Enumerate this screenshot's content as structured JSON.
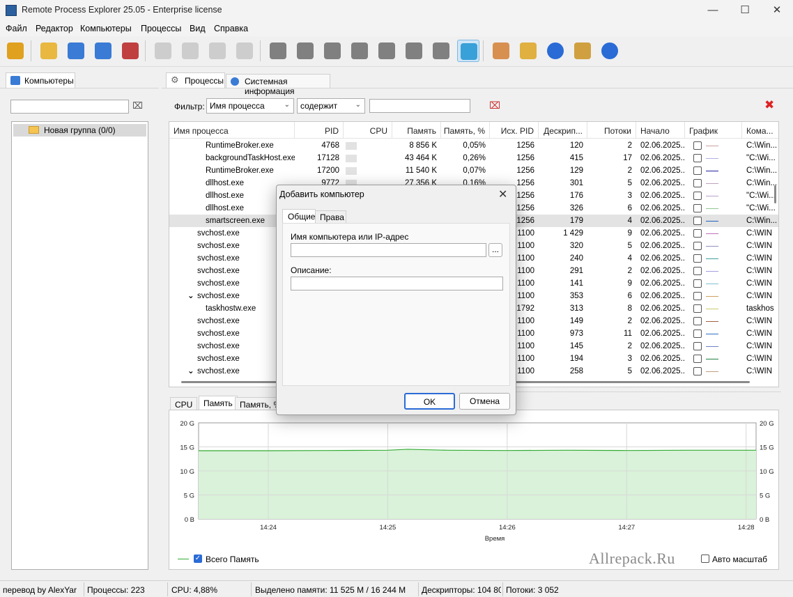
{
  "window": {
    "title": "Remote Process Explorer 25.05 - Enterprise license",
    "min_glyph": "—",
    "max_glyph": "☐",
    "close_glyph": "✕"
  },
  "menu": [
    "Файл",
    "Редактор",
    "Компьютеры",
    "Процессы",
    "Вид",
    "Справка"
  ],
  "toolbar_icons": [
    "wizard-icon",
    "add-folder-icon",
    "add-computer-icon",
    "edit-computer-icon",
    "remove-computer-icon",
    "run-process-icon",
    "run-as-icon",
    "kill-process-icon",
    "kill-tree-icon",
    "service-settings-icon",
    "add-service-icon",
    "remove-service-icon",
    "service-priority-icon",
    "find-service-icon",
    "network-service-icon",
    "service-properties-icon",
    "filter-icon",
    "user-key-icon",
    "tools-icon",
    "help-icon",
    "home-icon",
    "info-icon"
  ],
  "left": {
    "tab": "Компьютеры",
    "filter_value": "",
    "tree_item": "Новая группа (0/0)"
  },
  "tabs": {
    "processes": "Процессы",
    "sysinfo": "Системная информация"
  },
  "filter": {
    "label": "Фильтр:",
    "field": "Имя процесса",
    "op": "содержит",
    "value": ""
  },
  "columns": [
    "Имя процесса",
    "PID",
    "CPU",
    "Память",
    "Память, %",
    "Исх. PID",
    "Дескрип...",
    "Потоки",
    "Начало",
    "График",
    "Кома..."
  ],
  "rows": [
    {
      "name": "RuntimeBroker.exe",
      "indent": 2,
      "pid": "4768",
      "mem": "8 856 K",
      "memp": "0,05%",
      "ppid": "1256",
      "handles": "120",
      "threads": "2",
      "start": "02.06.2025...",
      "color": "#c9a0a0",
      "cmd": "C:\\Win..."
    },
    {
      "name": "backgroundTaskHost.exe",
      "indent": 2,
      "pid": "17128",
      "mem": "43 464 K",
      "memp": "0,26%",
      "ppid": "1256",
      "handles": "415",
      "threads": "17",
      "start": "02.06.2025...",
      "color": "#b0b0e0",
      "cmd": "\"C:\\Wi..."
    },
    {
      "name": "RuntimeBroker.exe",
      "indent": 2,
      "pid": "17200",
      "mem": "11 540 K",
      "memp": "0,07%",
      "ppid": "1256",
      "handles": "129",
      "threads": "2",
      "start": "02.06.2025...",
      "color": "#2020a0",
      "cmd": "C:\\Win..."
    },
    {
      "name": "dllhost.exe",
      "indent": 2,
      "pid": "9772",
      "mem": "27 356 K",
      "memp": "0,16%",
      "ppid": "1256",
      "handles": "301",
      "threads": "5",
      "start": "02.06.2025...",
      "color": "#c0a0c0",
      "cmd": "C:\\Win..."
    },
    {
      "name": "dllhost.exe",
      "indent": 2,
      "pid": "",
      "mem": "",
      "memp": "",
      "ppid": "1256",
      "handles": "176",
      "threads": "3",
      "start": "02.06.2025...",
      "color": "#b8a0c8",
      "cmd": "\"C:\\Wi..."
    },
    {
      "name": "dllhost.exe",
      "indent": 2,
      "pid": "",
      "mem": "",
      "memp": "",
      "ppid": "1256",
      "handles": "326",
      "threads": "6",
      "start": "02.06.2025...",
      "color": "#90c890",
      "cmd": "\"C:\\Wi..."
    },
    {
      "name": "smartscreen.exe",
      "indent": 2,
      "pid": "",
      "mem": "",
      "memp": "",
      "ppid": "1256",
      "handles": "179",
      "threads": "4",
      "start": "02.06.2025...",
      "color": "#2060c0",
      "cmd": "C:\\Win...",
      "selected": true
    },
    {
      "name": "svchost.exe",
      "indent": 1,
      "pid": "",
      "mem": "",
      "memp": "",
      "ppid": "1100",
      "handles": "1 429",
      "threads": "9",
      "start": "02.06.2025...",
      "color": "#c070c0",
      "cmd": "C:\\WIN"
    },
    {
      "name": "svchost.exe",
      "indent": 1,
      "pid": "",
      "mem": "",
      "memp": "",
      "ppid": "1100",
      "handles": "320",
      "threads": "5",
      "start": "02.06.2025...",
      "color": "#9090c0",
      "cmd": "C:\\WIN"
    },
    {
      "name": "svchost.exe",
      "indent": 1,
      "pid": "",
      "mem": "",
      "memp": "",
      "ppid": "1100",
      "handles": "240",
      "threads": "4",
      "start": "02.06.2025...",
      "color": "#40a0a0",
      "cmd": "C:\\WIN"
    },
    {
      "name": "svchost.exe",
      "indent": 1,
      "pid": "",
      "mem": "",
      "memp": "",
      "ppid": "1100",
      "handles": "291",
      "threads": "2",
      "start": "02.06.2025...",
      "color": "#a0a0e0",
      "cmd": "C:\\WIN"
    },
    {
      "name": "svchost.exe",
      "indent": 1,
      "pid": "",
      "mem": "",
      "memp": "",
      "ppid": "1100",
      "handles": "141",
      "threads": "9",
      "start": "02.06.2025...",
      "color": "#80c0d0",
      "cmd": "C:\\WIN"
    },
    {
      "name": "svchost.exe",
      "indent": 1,
      "expanded": true,
      "pid": "",
      "mem": "",
      "memp": "",
      "ppid": "1100",
      "handles": "353",
      "threads": "6",
      "start": "02.06.2025...",
      "color": "#d0a060",
      "cmd": "C:\\WIN"
    },
    {
      "name": "taskhostw.exe",
      "indent": 2,
      "pid": "",
      "mem": "",
      "memp": "",
      "ppid": "1792",
      "handles": "313",
      "threads": "8",
      "start": "02.06.2025...",
      "color": "#c8c870",
      "cmd": "taskhos"
    },
    {
      "name": "svchost.exe",
      "indent": 1,
      "pid": "",
      "mem": "",
      "memp": "",
      "ppid": "1100",
      "handles": "149",
      "threads": "2",
      "start": "02.06.2025...",
      "color": "#a06040",
      "cmd": "C:\\WIN"
    },
    {
      "name": "svchost.exe",
      "indent": 1,
      "pid": "",
      "mem": "",
      "memp": "",
      "ppid": "1100",
      "handles": "973",
      "threads": "11",
      "start": "02.06.2025...",
      "color": "#3070c0",
      "cmd": "C:\\WIN"
    },
    {
      "name": "svchost.exe",
      "indent": 1,
      "pid": "",
      "mem": "",
      "memp": "",
      "ppid": "1100",
      "handles": "145",
      "threads": "2",
      "start": "02.06.2025...",
      "color": "#7080c0",
      "cmd": "C:\\WIN"
    },
    {
      "name": "svchost.exe",
      "indent": 1,
      "pid": "",
      "mem": "",
      "memp": "",
      "ppid": "1100",
      "handles": "194",
      "threads": "3",
      "start": "02.06.2025...",
      "color": "#208040",
      "cmd": "C:\\WIN"
    },
    {
      "name": "svchost.exe",
      "indent": 1,
      "expanded": true,
      "pid": "",
      "mem": "",
      "memp": "",
      "ppid": "1100",
      "handles": "258",
      "threads": "5",
      "start": "02.06.2025...",
      "color": "#c0a080",
      "cmd": "C:\\WIN"
    }
  ],
  "bottom_tabs": [
    "CPU",
    "Память",
    "Память, %"
  ],
  "chart": {
    "y_ticks": [
      "20 G",
      "15 G",
      "10 G",
      "5 G",
      "0 B"
    ],
    "x_ticks": [
      "14:24",
      "14:25",
      "14:26",
      "14:27",
      "14:28"
    ],
    "xlabel": "Время",
    "legend": "Всего Память",
    "autoscale": "Авто масштаб",
    "watermark": "Allrepack.Ru",
    "fill": "#d9f2d9",
    "line": "#33aa33"
  },
  "chart_data": {
    "type": "area",
    "x": [
      "14:23:25",
      "14:24",
      "14:24:30",
      "14:25",
      "14:25:10",
      "14:25:30",
      "14:26",
      "14:26:30",
      "14:27",
      "14:27:30",
      "14:28",
      "14:28:05"
    ],
    "series": [
      {
        "name": "Всего Память",
        "values": [
          14.2,
          14.2,
          14.25,
          14.3,
          14.5,
          14.3,
          14.25,
          14.3,
          14.25,
          14.3,
          14.3,
          14.3
        ]
      }
    ],
    "ylim": [
      0,
      20
    ],
    "y_unit": "G",
    "xlabel": "Время",
    "ylabel": "",
    "grid": true,
    "legend": "bottom-left"
  },
  "status": {
    "translator": "перевод by AlexYar",
    "processes": "Процессы: 223",
    "cpu": "CPU: 4,88%",
    "memory": "Выделено памяти: 11 525 M / 16 244 M",
    "handles": "Дескрипторы: 104 80",
    "threads": "Потоки: 3 052"
  },
  "dialog": {
    "title": "Добавить компьютер",
    "tabs": [
      "Общие",
      "Права"
    ],
    "name_label": "Имя компьютера или IP-адрес",
    "name_value": "",
    "browse": "...",
    "desc_label": "Описание:",
    "desc_value": "",
    "ok": "OK",
    "cancel": "Отмена"
  }
}
